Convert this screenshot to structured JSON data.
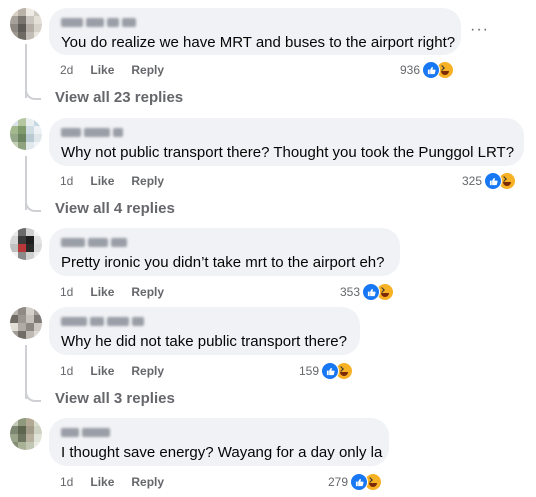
{
  "comments": [
    {
      "text": "You do realize we have MRT and buses to the airport right?",
      "time": "2d",
      "like": "Like",
      "reply": "Reply",
      "reactions": "936",
      "avatar_colors": [
        "#d8d0c5",
        "#b9b2a8",
        "#efeae3",
        "#cfcac2",
        "#a6a19a",
        "#7a756f",
        "#c9c4bc",
        "#e3ded6",
        "#8d8881",
        "#5e5a55",
        "#b3ada5",
        "#d6d1c9",
        "#9d988f",
        "#6f6a63",
        "#c2bdb5",
        "#e8e4de"
      ],
      "replies_link": "View all 23 replies"
    },
    {
      "text": "Why not public transport there? Thought you took the Punggol LRT?",
      "time": "1d",
      "like": "Like",
      "reply": "Reply",
      "reactions": "325",
      "avatar_colors": [
        "#d9e4ea",
        "#b4c7a0",
        "#e9eef1",
        "#c8d8e2",
        "#a3b88c",
        "#7f9a6b",
        "#d0dce4",
        "#eef2f4",
        "#95a88a",
        "#6c8460",
        "#b9cad3",
        "#dfe7eb",
        "#c4d1b8",
        "#8fa37f",
        "#e2e9ed",
        "#f2f5f7"
      ],
      "replies_link": "View all 4 replies"
    },
    {
      "text": "Pretty ironic you didn’t take mrt to the airport eh?",
      "time": "1d",
      "like": "Like",
      "reply": "Reply",
      "reactions": "353",
      "avatar_colors": [
        "#e9e9e9",
        "#6a6a6a",
        "#cfcfcf",
        "#f4f4f4",
        "#d6d6d6",
        "#3a3a3a",
        "#1e1e1e",
        "#e2e2e2",
        "#c0c0c0",
        "#b8383a",
        "#2a2a2a",
        "#dadada",
        "#f0f0f0",
        "#8a8a8a",
        "#cfcfcf",
        "#ececec"
      ],
      "replies_link": ""
    },
    {
      "text": "Why he did not take public transport there?",
      "time": "1d",
      "like": "Like",
      "reply": "Reply",
      "reactions": "159",
      "avatar_colors": [
        "#b7b3ad",
        "#8f8a84",
        "#d4d0ca",
        "#a5a09a",
        "#6f6a64",
        "#9b968f",
        "#c6c1ba",
        "#7e7974",
        "#e1ddd7",
        "#b0aba4",
        "#8c8780",
        "#cdc8c1",
        "#a29d96",
        "#716c66",
        "#bfbab3",
        "#dcd8d2"
      ],
      "replies_link": "View all 3 replies"
    },
    {
      "text": "I thought save energy? Wayang for a day only la",
      "time": "1d",
      "like": "Like",
      "reply": "Reply",
      "reactions": "279",
      "avatar_colors": [
        "#c5cbb9",
        "#8f9a7c",
        "#b3a995",
        "#d7dccd",
        "#7d8670",
        "#5e664f",
        "#a39c88",
        "#cdd2c2",
        "#9aa48a",
        "#6d7560",
        "#b8b09c",
        "#e0e4d8",
        "#858e75",
        "#a9b196",
        "#c1c7b3",
        "#e8ebe2"
      ],
      "replies_link": ""
    }
  ],
  "icons": {
    "like": "thumbs-up-icon",
    "haha": "haha-face-icon",
    "more": "more-options-icon"
  },
  "colors": {
    "like_blue": "#1877f2",
    "haha_yellow": "#f7b125",
    "bubble": "#f0f2f5",
    "meta": "#65676b"
  }
}
